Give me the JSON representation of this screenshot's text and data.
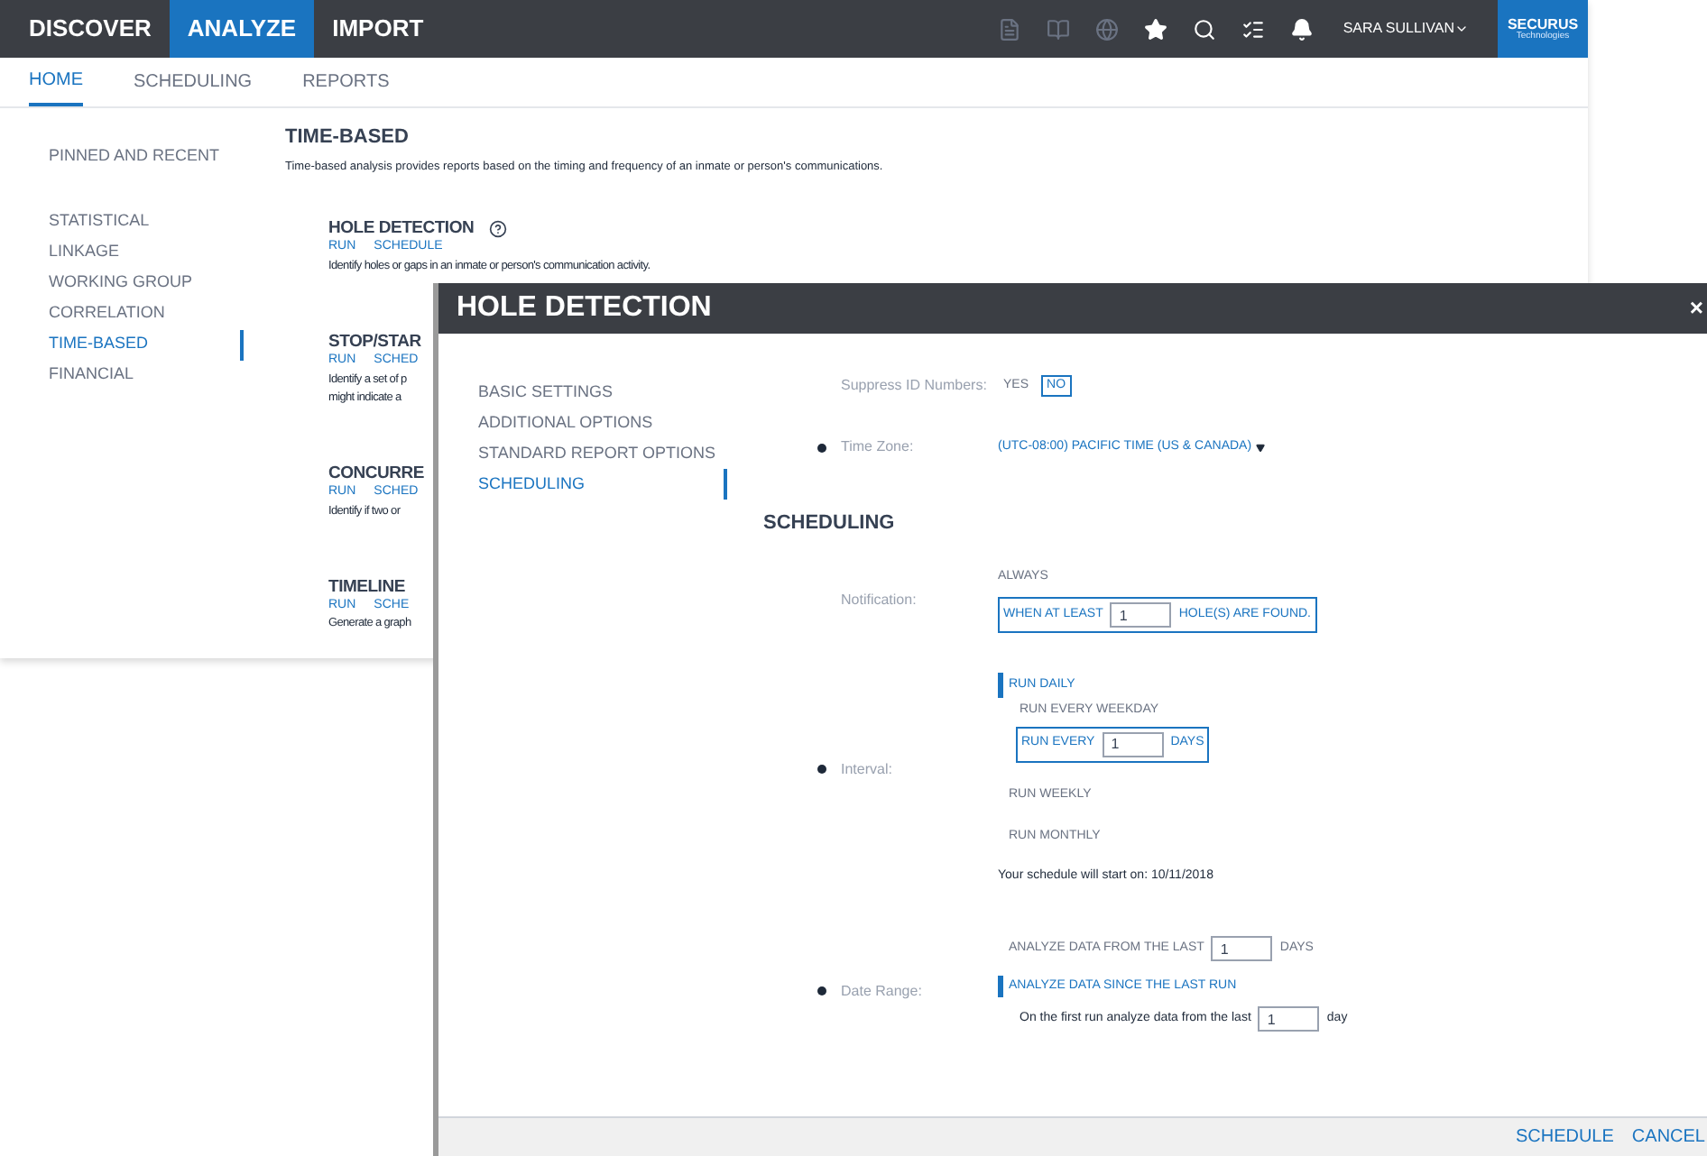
{
  "topbar": {
    "tabs": [
      {
        "label": "DISCOVER",
        "selected": false
      },
      {
        "label": "ANALYZE",
        "selected": true
      },
      {
        "label": "IMPORT",
        "selected": false
      }
    ],
    "icons": [
      {
        "kind": "file",
        "disabled": true
      },
      {
        "kind": "book",
        "disabled": true
      },
      {
        "kind": "globe",
        "disabled": true
      },
      {
        "kind": "star",
        "disabled": false
      },
      {
        "kind": "search",
        "disabled": false
      },
      {
        "kind": "list",
        "disabled": false
      },
      {
        "kind": "bell",
        "disabled": false
      }
    ],
    "user": "SARA SULLIVAN",
    "logo": {
      "name": "SECURUS",
      "tagline": "Technologies"
    }
  },
  "subnav": [
    {
      "label": "HOME",
      "selected": true
    },
    {
      "label": "SCHEDULING",
      "selected": false
    },
    {
      "label": "REPORTS",
      "selected": false
    }
  ],
  "sidebar": {
    "pinned": "PINNED AND RECENT",
    "items": [
      {
        "label": "STATISTICAL",
        "selected": false
      },
      {
        "label": "LINKAGE",
        "selected": false
      },
      {
        "label": "WORKING GROUP",
        "selected": false
      },
      {
        "label": "CORRELATION",
        "selected": false
      },
      {
        "label": "TIME-BASED",
        "selected": true
      },
      {
        "label": "FINANCIAL",
        "selected": false
      }
    ]
  },
  "section": {
    "title": "TIME-BASED",
    "description": "Time-based analysis provides reports based on the timing and frequency of an inmate or person's communications."
  },
  "reports": [
    {
      "title": "HOLE DETECTION",
      "help": true,
      "links": [
        "RUN",
        "SCHEDULE"
      ],
      "description": [
        "Identify holes or gaps in an inmate or person's communication activity."
      ]
    },
    {
      "title": "STOP/STAR",
      "help": false,
      "links": [
        "RUN",
        "SCHED"
      ],
      "description": [
        "Identify a set of p",
        "might indicate a"
      ]
    },
    {
      "title": "CONCURRE",
      "help": false,
      "links": [
        "RUN",
        "SCHED"
      ],
      "description": [
        "Identify if two or"
      ]
    },
    {
      "title": "TIMELINE",
      "help": false,
      "links": [
        "RUN",
        "SCHE"
      ],
      "description": [
        "Generate a graph"
      ]
    }
  ],
  "dialog": {
    "title": "HOLE DETECTION",
    "close": "×",
    "nav": [
      {
        "label": "BASIC SETTINGS",
        "selected": false
      },
      {
        "label": "ADDITIONAL OPTIONS",
        "selected": false
      },
      {
        "label": "STANDARD REPORT OPTIONS",
        "selected": false
      },
      {
        "label": "SCHEDULING",
        "selected": true
      }
    ],
    "suppress": {
      "label": "Suppress ID Numbers:",
      "required": false,
      "options": [
        {
          "label": "YES",
          "selected": false
        },
        {
          "label": "NO",
          "selected": true
        }
      ]
    },
    "timezone": {
      "label": "Time Zone:",
      "required": true,
      "value": "(UTC-08:00) PACIFIC TIME (US & CANADA)"
    },
    "heading": "SCHEDULING",
    "notification": {
      "label": "Notification:",
      "required": false,
      "always": {
        "label": "ALWAYS",
        "selected": false
      },
      "threshold": {
        "before": "WHEN AT LEAST",
        "value": "1",
        "after": "HOLE(S) ARE FOUND.",
        "selected": true
      }
    },
    "interval": {
      "label": "Interval:",
      "required": true,
      "options": [
        {
          "kind": "group",
          "label": "RUN DAILY",
          "selected": true,
          "sub": [
            {
              "kind": "plain",
              "label": "RUN EVERY WEEKDAY",
              "selected": false
            },
            {
              "kind": "input",
              "before": "RUN EVERY",
              "value": "1",
              "after": "DAYS",
              "selected": true
            }
          ]
        },
        {
          "kind": "plain",
          "label": "RUN WEEKLY",
          "selected": false
        },
        {
          "kind": "plain",
          "label": "RUN MONTHLY",
          "selected": false
        }
      ],
      "note": "Your schedule will start on: 10/11/2018"
    },
    "daterange": {
      "label": "Date Range:",
      "required": true,
      "options": [
        {
          "before": "ANALYZE DATA FROM THE LAST",
          "value": "1",
          "after": "DAYS",
          "selected": false
        },
        {
          "label": "ANALYZE DATA SINCE THE LAST RUN",
          "selected": true,
          "sub": {
            "before": "On the first run analyze data from the last",
            "value": "1",
            "after": "day"
          }
        }
      ]
    },
    "buttons": [
      "SCHEDULE",
      "CANCEL"
    ]
  }
}
